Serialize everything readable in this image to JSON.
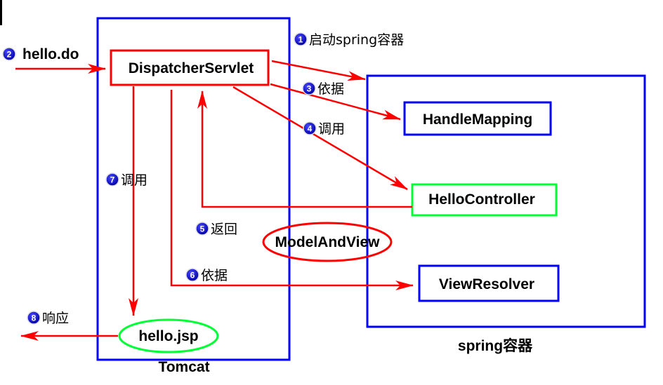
{
  "containers": {
    "tomcat": "Tomcat",
    "spring": "spring容器"
  },
  "components": {
    "dispatcher": "DispatcherServlet",
    "handle_mapping": "HandleMapping",
    "hello_controller": "HelloController",
    "model_and_view": "ModelAndView",
    "view_resolver": "ViewResolver",
    "hello_jsp": "hello.jsp"
  },
  "steps": [
    {
      "num": "1",
      "label": "启动spring容器"
    },
    {
      "num": "2",
      "label": "hello.do"
    },
    {
      "num": "3",
      "label": "依据"
    },
    {
      "num": "4",
      "label": "调用"
    },
    {
      "num": "5",
      "label": "返回"
    },
    {
      "num": "6",
      "label": "依据"
    },
    {
      "num": "7",
      "label": "调用"
    },
    {
      "num": "8",
      "label": "响应"
    }
  ],
  "colors": {
    "blue": "#0000ff",
    "red": "#ff0000",
    "green": "#00ff33",
    "badge": "#0000cc"
  }
}
